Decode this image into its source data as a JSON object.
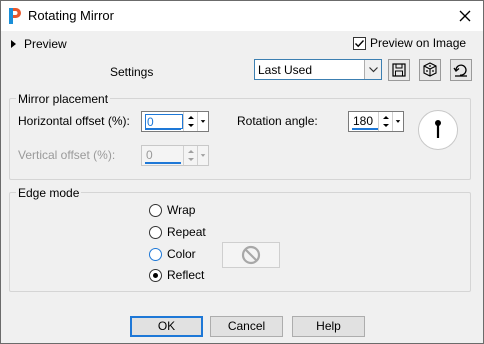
{
  "window": {
    "title": "Rotating Mirror",
    "app_icon": "paintshop-icon",
    "close_icon": "close-icon"
  },
  "preview": {
    "toggle_label": "Preview",
    "preview_on_image_label": "Preview on Image",
    "preview_on_image_checked": true
  },
  "settings": {
    "label": "Settings",
    "preset_value": "Last Used",
    "toolbar_icons": [
      "save-preset-icon",
      "randomize-icon",
      "reset-icon"
    ]
  },
  "mirror_placement": {
    "title": "Mirror placement",
    "horizontal_offset_label": "Horizontal offset (%):",
    "horizontal_offset_value": "0",
    "vertical_offset_label": "Vertical offset (%):",
    "vertical_offset_value": "0",
    "rotation_angle_label": "Rotation angle:",
    "rotation_angle_value": "180",
    "dial_icon": "angle-dial-icon"
  },
  "edge_mode": {
    "title": "Edge mode",
    "options": [
      "Wrap",
      "Repeat",
      "Color",
      "Reflect"
    ],
    "selected": "Reflect",
    "color_icon": "no-color-icon"
  },
  "buttons": {
    "ok": "OK",
    "cancel": "Cancel",
    "help": "Help"
  },
  "colors": {
    "accent": "#1e78d7",
    "dialog_bg": "#f0f0f0"
  }
}
